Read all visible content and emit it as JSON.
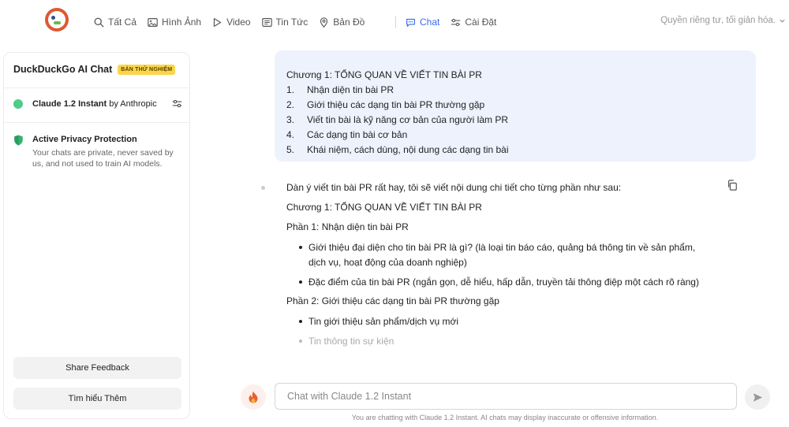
{
  "nav": {
    "items": [
      {
        "label": "Tất Cả",
        "icon": "search-icon"
      },
      {
        "label": "Hình Ảnh",
        "icon": "image-icon"
      },
      {
        "label": "Video",
        "icon": "play-icon"
      },
      {
        "label": "Tin Tức",
        "icon": "news-icon"
      },
      {
        "label": "Bản Đồ",
        "icon": "map-pin-icon"
      }
    ],
    "chat_label": "Chat",
    "settings_label": "Cài Đặt",
    "privacy_text": "Quyền riêng tư, tối giản hóa.",
    "accent_color": "#3969ef"
  },
  "sidebar": {
    "title": "DuckDuckGo AI Chat",
    "badge": "BẢN THỬ NGHIỆM",
    "model_name": "Claude 1.2 Instant",
    "model_by": " by Anthropic",
    "privacy_title": "Active Privacy Protection",
    "privacy_desc": "Your chats are private, never saved by us, and not used to train AI models.",
    "feedback_button": "Share Feedback",
    "learn_more_button": "Tìm hiểu Thêm"
  },
  "user_message": {
    "heading": "Chương 1: TỔNG QUAN VỀ VIẾT TIN BÀI PR",
    "items": [
      {
        "num": "1.",
        "text": "Nhận diện tin bài PR"
      },
      {
        "num": "2.",
        "text": "Giới thiệu các dạng tin bài PR thường gặp"
      },
      {
        "num": "3.",
        "text": "Viết tin bài là kỹ năng cơ bản của người làm PR"
      },
      {
        "num": "4.",
        "text": "Các dạng tin bài cơ bản"
      },
      {
        "num": "5.",
        "text": "Khái niệm, cách dùng, nội dung các dạng tin bài"
      }
    ]
  },
  "ai_message": {
    "intro": "Dàn ý viết tin bài PR rất hay, tôi sẽ viết nội dung chi tiết cho từng phần như sau:",
    "chapter": "Chương 1: TỔNG QUAN VỀ VIẾT TIN BÀI PR",
    "part1": "Phần 1: Nhận diện tin bài PR",
    "part1_bullets": [
      "Giới thiệu đại diện cho tin bài PR là gì? (là loại tin báo cáo, quảng bá thông tin về sản phẩm, dịch vụ, hoạt động của doanh nghiệp)",
      "Đặc điểm của tin bài PR (ngắn gọn, dễ hiểu, hấp dẫn, truyền tải thông điệp một cách rõ ràng)"
    ],
    "part2": "Phần 2: Giới thiệu các dạng tin bài PR thường gặp",
    "part2_bullets": [
      "Tin giới thiệu sản phẩm/dịch vụ mới",
      "Tin thông tin sự kiện"
    ]
  },
  "input": {
    "placeholder": "Chat with Claude 1.2 Instant",
    "disclaimer": "You are chatting with Claude 1.2 Instant. AI chats may display inaccurate or offensive information."
  }
}
